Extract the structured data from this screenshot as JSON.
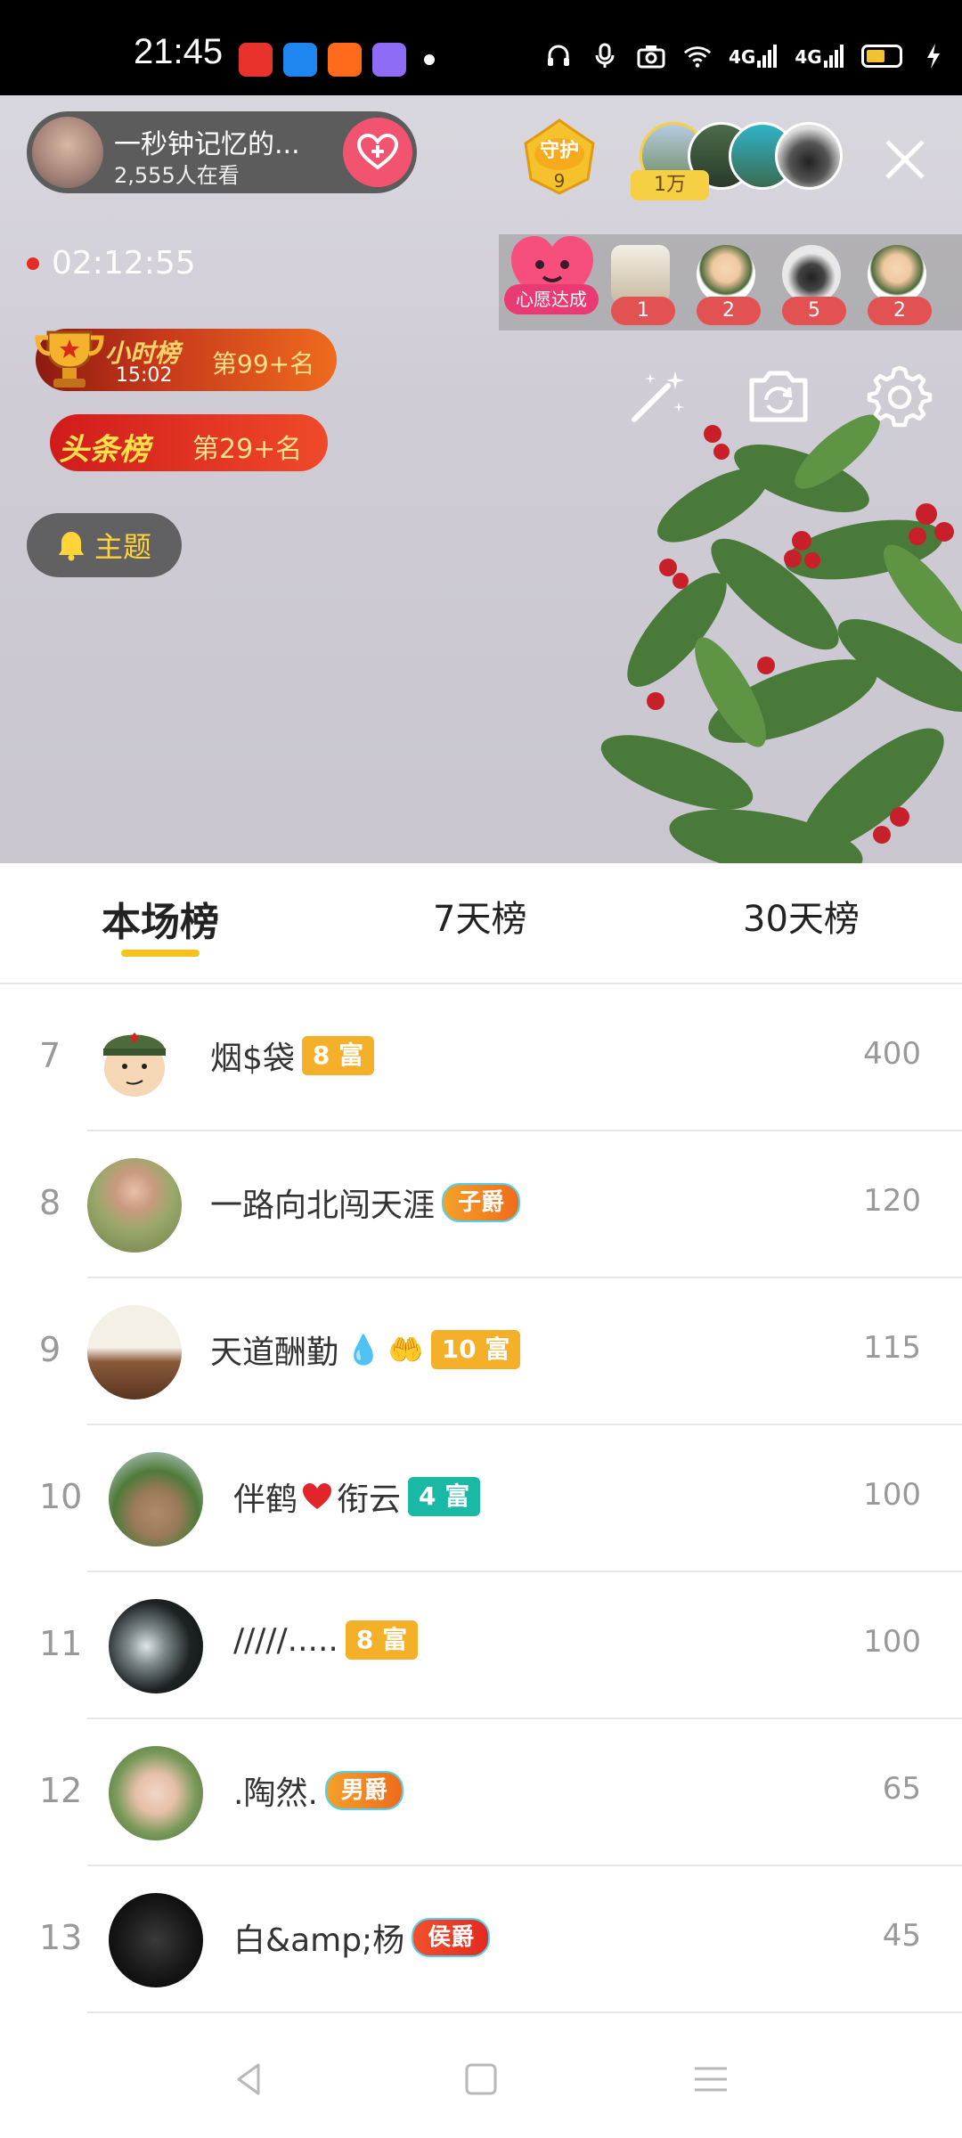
{
  "status_bar": {
    "time": "21:45",
    "network_1": "4G",
    "network_2": "4G",
    "colors": {
      "battery": "#f2c230"
    }
  },
  "live": {
    "host": {
      "name": "一秒钟记忆的...",
      "viewers": "2,555人在看"
    },
    "guard": {
      "label": "守护",
      "count": "9"
    },
    "top_badge": "1万",
    "timer": "02:12:55",
    "wish": {
      "label": "心愿达成",
      "slots": [
        {
          "count": "1"
        },
        {
          "count": "2"
        },
        {
          "count": "5"
        },
        {
          "count": "2"
        }
      ]
    },
    "hour_rank": {
      "title": "小时榜",
      "time": "15:02",
      "rank": "第99+名"
    },
    "headline_rank": {
      "title": "头条榜",
      "rank": "第29+名"
    },
    "topic_button": "主题"
  },
  "tabs": [
    {
      "label": "本场榜",
      "active": true
    },
    {
      "label": "7天榜",
      "active": false
    },
    {
      "label": "30天榜",
      "active": false
    }
  ],
  "ranking": [
    {
      "rank": "7",
      "name": "烟$袋",
      "badge": "8 富",
      "badge_type": "rich-orange",
      "score": "400"
    },
    {
      "rank": "8",
      "name": "一路向北闯天涯",
      "badge": "子爵",
      "badge_type": "title-orange",
      "score": "120"
    },
    {
      "rank": "9",
      "name": "天道酬勤",
      "badge": "10 富",
      "badge_type": "rich-orange",
      "score": "115"
    },
    {
      "rank": "10",
      "name_a": "伴鹤",
      "name_b": "衔云",
      "badge": "4 富",
      "badge_type": "rich-teal",
      "score": "100"
    },
    {
      "rank": "11",
      "name": "/////.....",
      "badge": "8 富",
      "badge_type": "rich-orange",
      "score": "100"
    },
    {
      "rank": "12",
      "name": ".陶然.",
      "badge": "男爵",
      "badge_type": "title-orange",
      "score": "65"
    },
    {
      "rank": "13",
      "name": "白&amp;杨",
      "badge": "侯爵",
      "badge_type": "title-red",
      "score": "45"
    }
  ],
  "icons": [
    "close-icon",
    "magic-wand-icon",
    "camera-flip-icon",
    "gear-icon",
    "bell-icon",
    "heart-plus-icon",
    "back-icon",
    "home-icon",
    "menu-icon"
  ],
  "colors": {
    "accent": "#f4c21a",
    "rich_orange": "#f5b02a",
    "rich_teal": "#19b9a5",
    "follow": "#f2546f"
  }
}
